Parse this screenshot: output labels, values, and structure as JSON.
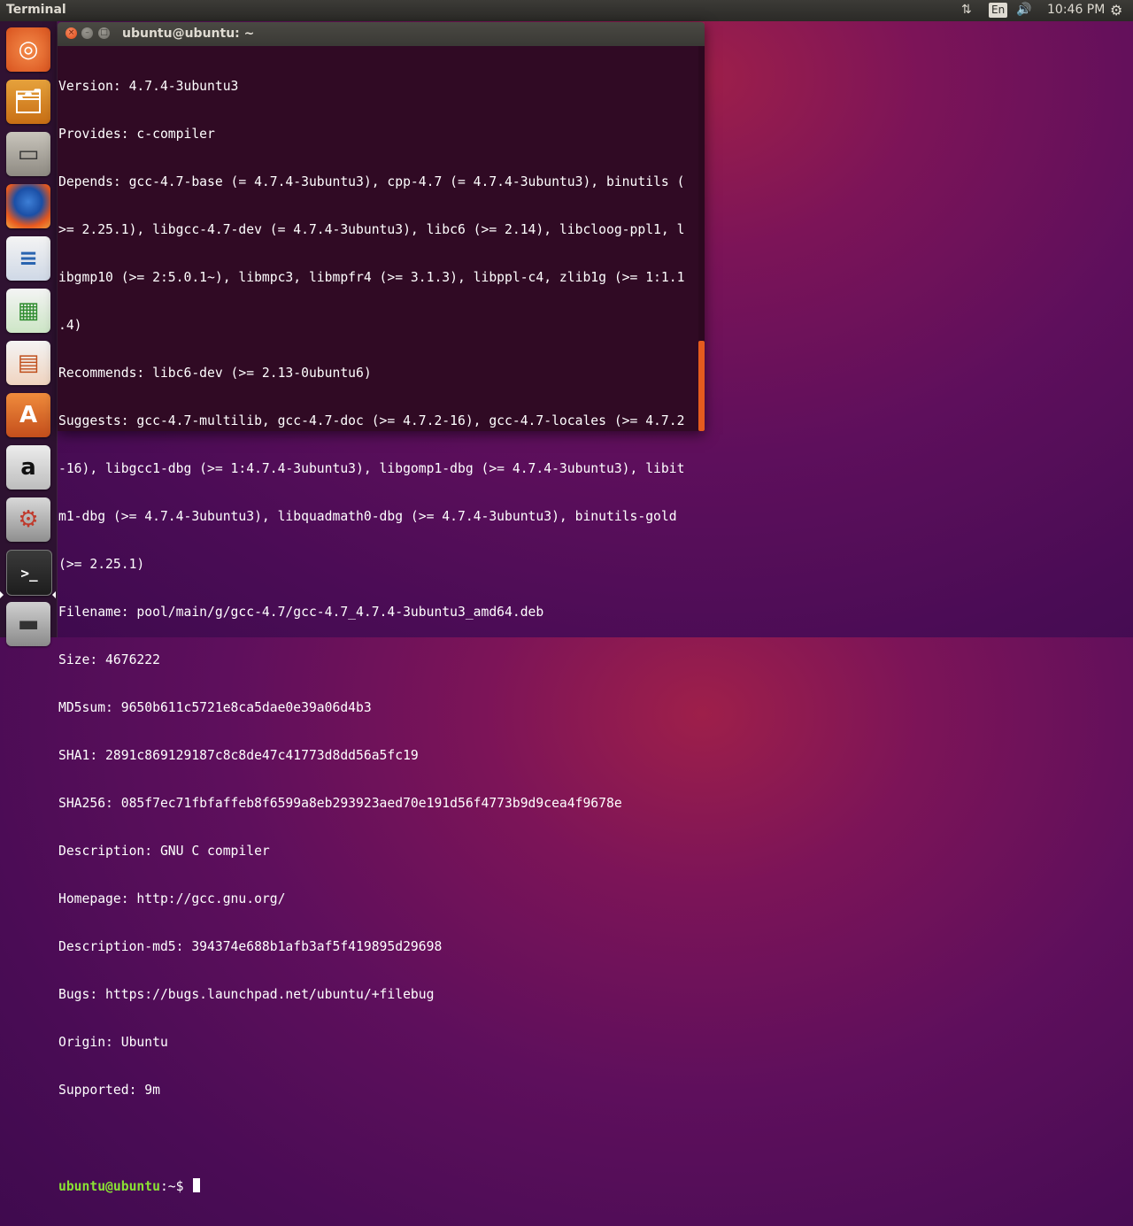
{
  "panel": {
    "app_title": "Terminal",
    "keyboard_layout": "En",
    "clock": "10:46 PM",
    "network_glyph": "⇅",
    "volume_glyph": "🔊",
    "settings_glyph": "⚙"
  },
  "launcher": {
    "items": [
      {
        "name": "dash-home",
        "glyph": "◎"
      },
      {
        "name": "files-manager",
        "glyph": "🗂"
      },
      {
        "name": "files-cabinet",
        "glyph": "▭"
      },
      {
        "name": "firefox-browser",
        "glyph": ""
      },
      {
        "name": "libreoffice-writer",
        "glyph": "≡"
      },
      {
        "name": "libreoffice-calc",
        "glyph": "▦"
      },
      {
        "name": "libreoffice-impress",
        "glyph": "▤"
      },
      {
        "name": "ubuntu-software-center",
        "glyph": "A"
      },
      {
        "name": "amazon",
        "glyph": "a"
      },
      {
        "name": "system-settings",
        "glyph": "⚙"
      },
      {
        "name": "terminal",
        "glyph": ">_"
      },
      {
        "name": "disk-backup",
        "glyph": "▬"
      }
    ]
  },
  "window": {
    "title": "ubuntu@ubuntu: ~",
    "close_glyph": "×",
    "minimize_glyph": "–",
    "maximize_glyph": "□"
  },
  "terminal": {
    "lines": [
      "Version: 4.7.4-3ubuntu3",
      "Provides: c-compiler",
      "Depends: gcc-4.7-base (= 4.7.4-3ubuntu3), cpp-4.7 (= 4.7.4-3ubuntu3), binutils (",
      ">= 2.25.1), libgcc-4.7-dev (= 4.7.4-3ubuntu3), libc6 (>= 2.14), libcloog-ppl1, l",
      "ibgmp10 (>= 2:5.0.1~), libmpc3, libmpfr4 (>= 3.1.3), libppl-c4, zlib1g (>= 1:1.1",
      ".4)",
      "Recommends: libc6-dev (>= 2.13-0ubuntu6)",
      "Suggests: gcc-4.7-multilib, gcc-4.7-doc (>= 4.7.2-16), gcc-4.7-locales (>= 4.7.2",
      "-16), libgcc1-dbg (>= 1:4.7.4-3ubuntu3), libgomp1-dbg (>= 4.7.4-3ubuntu3), libit",
      "m1-dbg (>= 4.7.4-3ubuntu3), libquadmath0-dbg (>= 4.7.4-3ubuntu3), binutils-gold",
      "(>= 2.25.1)",
      "Filename: pool/main/g/gcc-4.7/gcc-4.7_4.7.4-3ubuntu3_amd64.deb",
      "Size: 4676222",
      "MD5sum: 9650b611c5721e8ca5dae0e39a06d4b3",
      "SHA1: 2891c869129187c8c8de47c41773d8dd56a5fc19",
      "SHA256: 085f7ec71fbfaffeb8f6599a8eb293923aed70e191d56f4773b9d9cea4f9678e",
      "Description: GNU C compiler",
      "Homepage: http://gcc.gnu.org/",
      "Description-md5: 394374e688b1afb3af5f419895d29698",
      "Bugs: https://bugs.launchpad.net/ubuntu/+filebug",
      "Origin: Ubuntu",
      "Supported: 9m",
      ""
    ],
    "prompt_user_host": "ubuntu@ubuntu",
    "prompt_path_symbol": ":~$ ",
    "scroll_position_fraction": 0.77
  },
  "colors": {
    "terminal_background": "#300a24",
    "prompt_color": "#8ae234",
    "accent_orange": "#e55b1e"
  }
}
